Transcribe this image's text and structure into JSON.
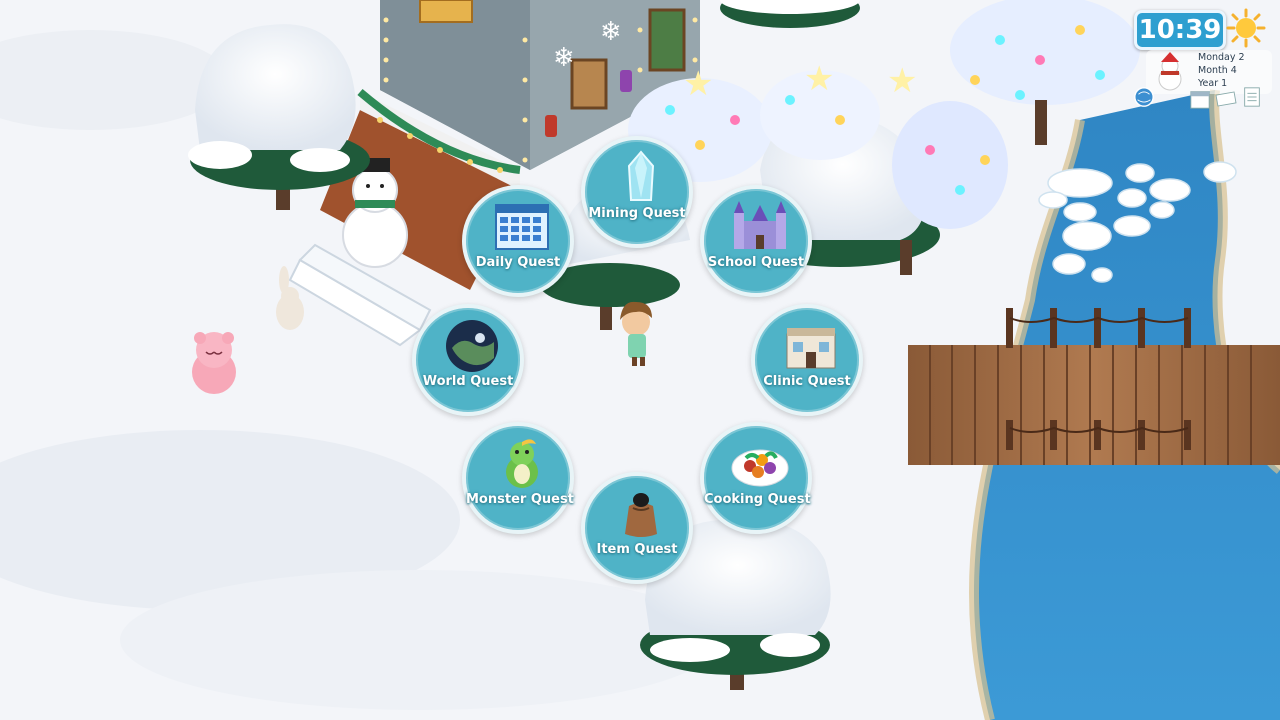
{
  "hud": {
    "time": "10:39",
    "day": "Monday 2",
    "month": "Month 4",
    "year": "Year 1",
    "weather_icon": "sun-icon"
  },
  "quest_menu": {
    "items": [
      {
        "label": "Mining Quest",
        "icon": "ice-crystal-icon"
      },
      {
        "label": "Daily Quest",
        "icon": "calendar-icon"
      },
      {
        "label": "School Quest",
        "icon": "castle-icon"
      },
      {
        "label": "World Quest",
        "icon": "globe-icon"
      },
      {
        "label": "Clinic Quest",
        "icon": "clinic-building-icon"
      },
      {
        "label": "Monster Quest",
        "icon": "monster-icon"
      },
      {
        "label": "Cooking Quest",
        "icon": "salad-plate-icon"
      },
      {
        "label": "Item Quest",
        "icon": "item-bag-icon"
      }
    ]
  },
  "colors": {
    "quest_bubble": "#4fb3c7",
    "river": "#3a8fcc",
    "snow": "#f4f6fa",
    "bridge": "#9b6a45"
  }
}
